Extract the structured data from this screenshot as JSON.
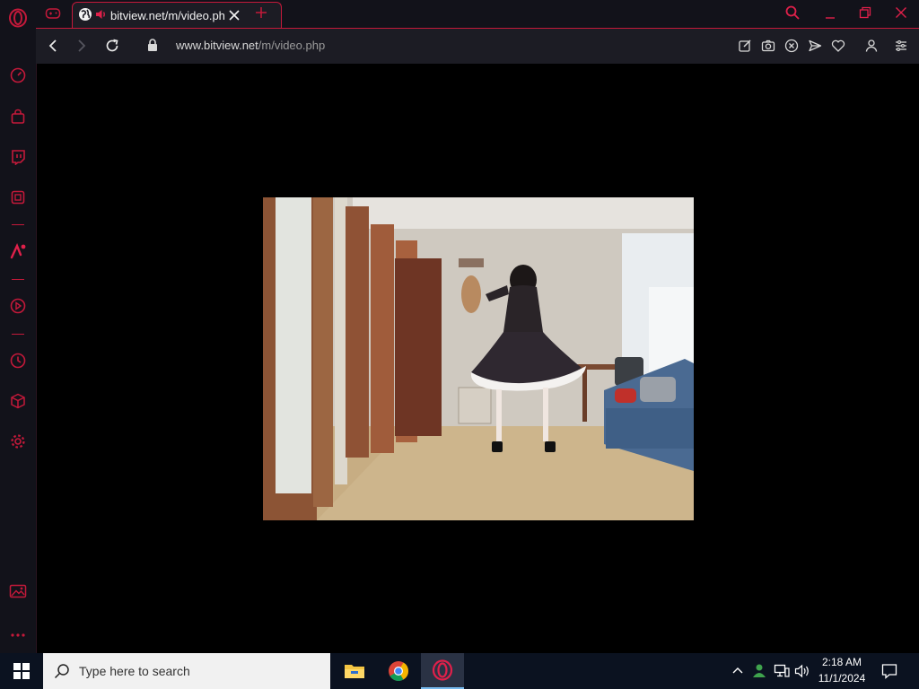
{
  "colors": {
    "accent": "#c4193a",
    "chrome_bg": "#12121a",
    "toolbar_bg": "#1c1c24",
    "page_bg": "#000000",
    "taskbar_bg": "#0b1220"
  },
  "sidebar": {
    "items": [
      {
        "icon": "opera-logo-icon"
      },
      {
        "icon": "speed-dial-icon"
      },
      {
        "icon": "shopping-bag-icon"
      },
      {
        "icon": "twitch-icon"
      },
      {
        "icon": "tab-islands-icon"
      },
      {
        "icon": "aria-ai-icon"
      },
      {
        "icon": "player-icon"
      },
      {
        "icon": "history-icon"
      },
      {
        "icon": "extensions-icon"
      },
      {
        "icon": "settings-icon"
      },
      {
        "icon": "wallpaper-icon"
      },
      {
        "icon": "more-icon"
      }
    ]
  },
  "tabs": {
    "active": {
      "title": "bitview.net/m/video.php",
      "audio_icon": "speaker-icon",
      "favicon": "globe-icon"
    }
  },
  "address": {
    "url_host": "www.bitview.net",
    "url_path": "/m/video.php"
  },
  "taskbar": {
    "search_placeholder": "Type here to search",
    "time": "2:18 AM",
    "date": "11/1/2024"
  }
}
